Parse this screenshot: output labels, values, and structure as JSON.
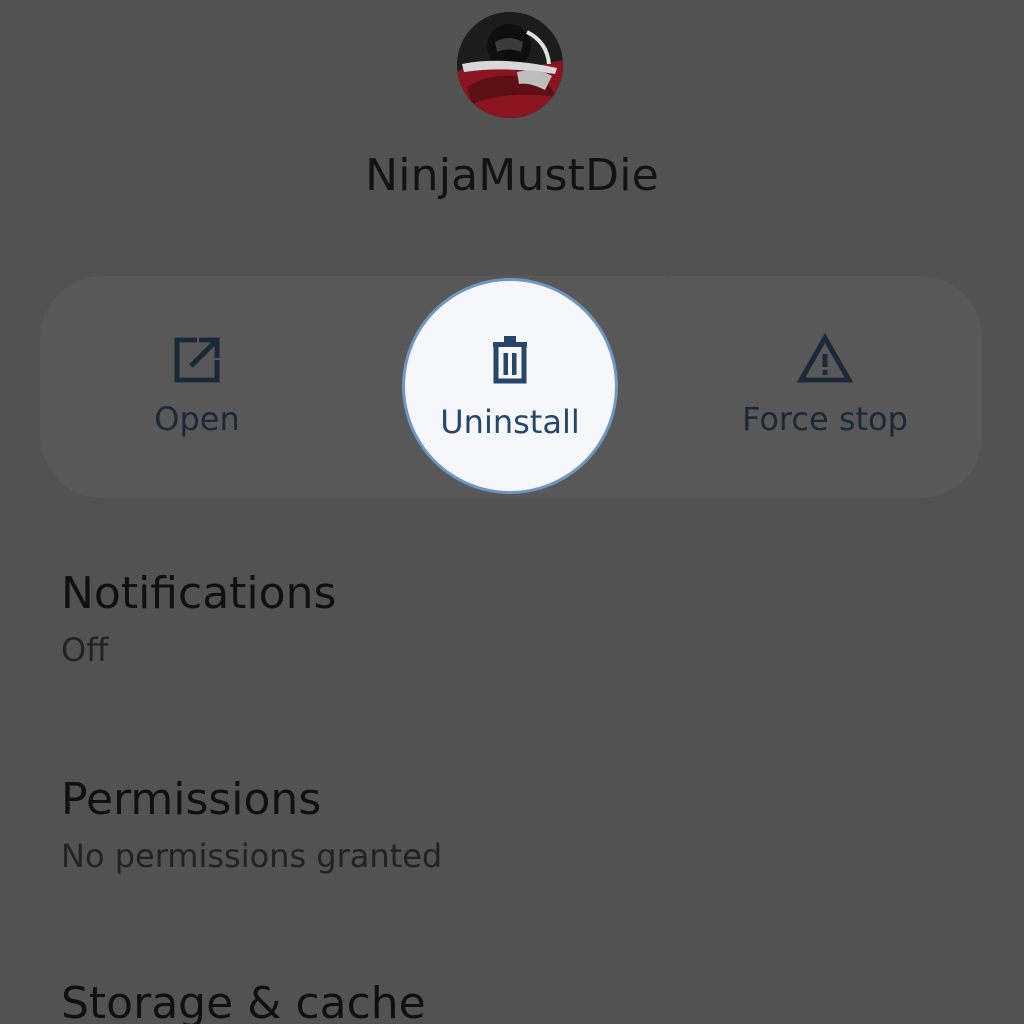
{
  "app": {
    "name": "NinjaMustDie",
    "icon": "ninja-app-icon"
  },
  "actions": {
    "open": {
      "label": "Open",
      "icon": "open-external-icon"
    },
    "uninstall": {
      "label": "Uninstall",
      "icon": "trash-icon"
    },
    "force_stop": {
      "label": "Force stop",
      "icon": "warning-icon"
    }
  },
  "settings": [
    {
      "title": "Notifications",
      "subtitle": "Off"
    },
    {
      "title": "Permissions",
      "subtitle": "No permissions granted"
    },
    {
      "title": "Storage & cache"
    }
  ],
  "colors": {
    "dim_background": "#525252",
    "highlight_fill": "#f5f7fb",
    "highlight_ring": "#6f97bf",
    "icon_color": "#1a2838"
  }
}
